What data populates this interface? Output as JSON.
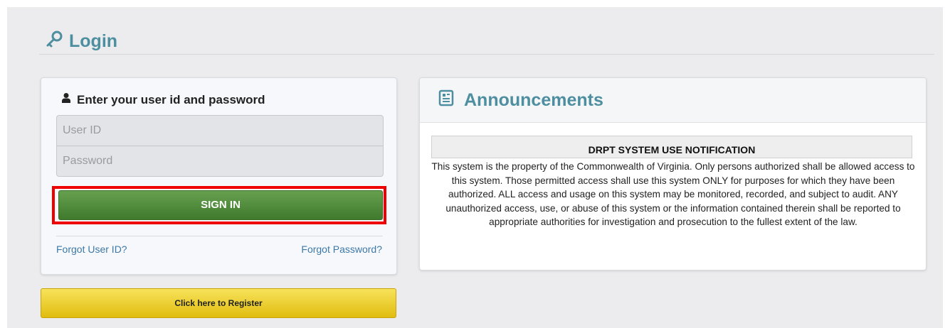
{
  "page": {
    "title": "Login",
    "title_icon": "key-icon"
  },
  "login": {
    "heading": "Enter your user id and password",
    "heading_icon": "user-icon",
    "user_id_placeholder": "User ID",
    "password_placeholder": "Password",
    "sign_in_label": "SIGN IN",
    "forgot_user_id": "Forgot User ID?",
    "forgot_password": "Forgot Password?"
  },
  "register": {
    "label": "Click here to Register"
  },
  "announcements": {
    "title": "Announcements",
    "title_icon": "document-icon",
    "notification_title": "DRPT SYSTEM USE NOTIFICATION",
    "notification_body": "This system is the property of the Commonwealth of Virginia. Only persons authorized shall be allowed access to this system. Those permitted access shall use this system ONLY for purposes for which they have been authorized. ALL access and usage on this system may be monitored, recorded, and subject to audit. ANY unauthorized access, use, or abuse of this system or the information contained therein shall be reported to appropriate authorities for investigation and prosecution to the fullest extent of the law."
  },
  "colors": {
    "accent": "#4d8fa0",
    "sign_in_button": "#4c8a38",
    "register_button": "#ecce2a",
    "highlight_outline": "#ee0000",
    "link": "#3c78a8"
  }
}
